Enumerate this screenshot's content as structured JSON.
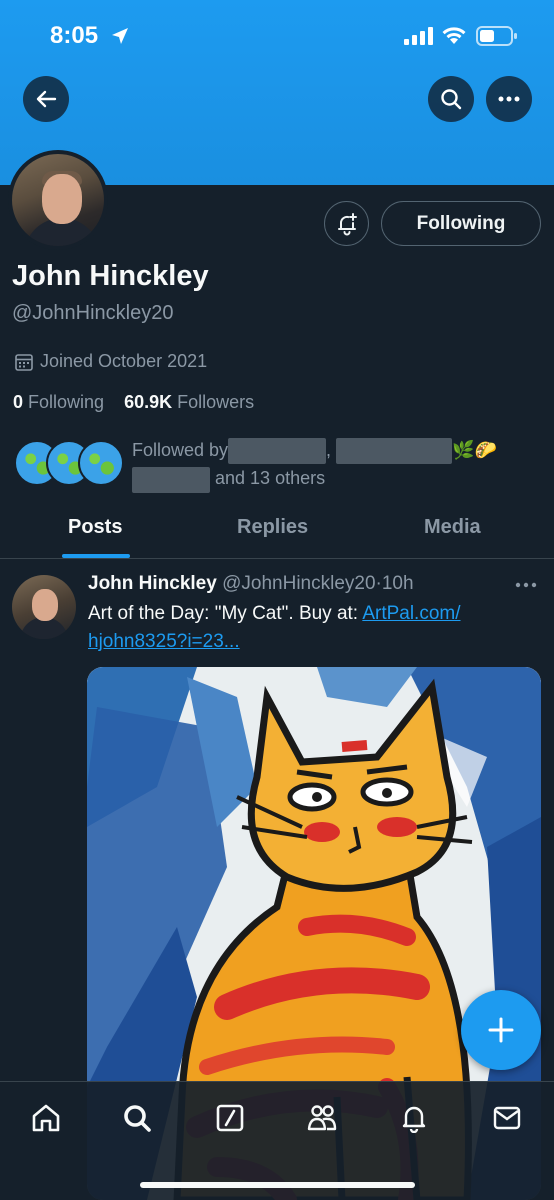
{
  "status_bar": {
    "time": "8:05"
  },
  "colors": {
    "accent": "#1d9bf0",
    "background": "#15202b",
    "muted": "#8b98a5"
  },
  "header": {
    "back_icon": "arrow-left-icon",
    "search_icon": "search-icon",
    "more_icon": "more-horizontal-icon"
  },
  "profile": {
    "name": "John Hinckley",
    "handle": "@JohnHinckley20",
    "joined": "Joined October 2021",
    "following_count": "0",
    "following_label": "Following",
    "followers_count": "60.9K",
    "followers_label": "Followers",
    "follow_button_label": "Following",
    "followed_by_prefix": "Followed by",
    "followed_by_suffix": "and 13 others",
    "followed_by_emoji": "🌿🌮"
  },
  "tabs": [
    {
      "label": "Posts",
      "active": true
    },
    {
      "label": "Replies",
      "active": false
    },
    {
      "label": "Media",
      "active": false
    }
  ],
  "post": {
    "author_name": "John Hinckley",
    "author_handle": "@JohnHinckley20",
    "separator": "·",
    "time": "10h",
    "text": "Art of the Day: \"My Cat\". Buy at: ",
    "link_text_1": "ArtPal.com/",
    "link_text_2": "hjohn8325?i=23..."
  },
  "fab": {
    "icon": "plus-icon"
  },
  "bottom_nav": [
    {
      "name": "home",
      "icon": "home-icon"
    },
    {
      "name": "search",
      "icon": "search-icon"
    },
    {
      "name": "grok",
      "icon": "slash-box-icon"
    },
    {
      "name": "communities",
      "icon": "people-icon"
    },
    {
      "name": "notifications",
      "icon": "bell-icon"
    },
    {
      "name": "messages",
      "icon": "mail-icon"
    }
  ]
}
